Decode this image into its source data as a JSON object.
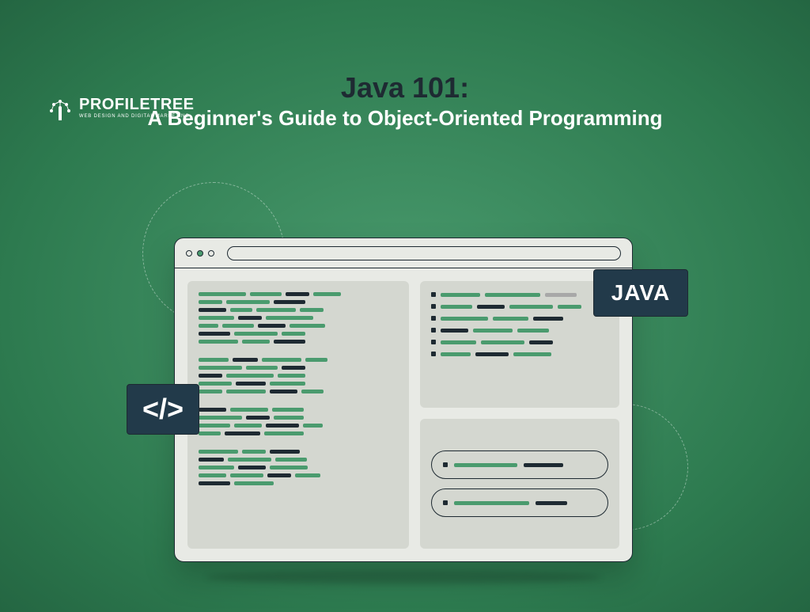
{
  "logo": {
    "main": "PROFILETREE",
    "sub": "WEB DESIGN AND DIGITAL MARKETING"
  },
  "heading": {
    "title": "Java 101:",
    "subtitle": "A Beginner's Guide to Object-Oriented Programming"
  },
  "badges": {
    "code": "</>",
    "java": "JAVA"
  }
}
